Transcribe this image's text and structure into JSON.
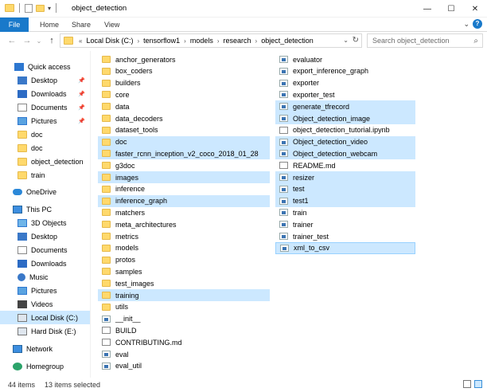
{
  "titlebar": {
    "title": "object_detection",
    "controls": {
      "minimize": "—",
      "maximize": "☐",
      "close": "✕"
    }
  },
  "ribbon": {
    "tabs": [
      "File",
      "Home",
      "Share",
      "View"
    ],
    "expand": "⌄",
    "help": "?"
  },
  "address": {
    "nav": {
      "back": "←",
      "forward": "→",
      "recent": "⌄",
      "up": "↑"
    },
    "crumbs": [
      "Local Disk (C:)",
      "tensorflow1",
      "models",
      "research",
      "object_detection"
    ],
    "search_placeholder": "Search object_detection"
  },
  "navpane": {
    "items": [
      {
        "label": "Quick access",
        "icon": "star-icon"
      },
      {
        "label": "Desktop",
        "icon": "desktop-icon",
        "pinned": true
      },
      {
        "label": "Downloads",
        "icon": "downloads-icon",
        "pinned": true
      },
      {
        "label": "Documents",
        "icon": "documents-icon",
        "pinned": true
      },
      {
        "label": "Pictures",
        "icon": "pictures-icon",
        "pinned": true
      },
      {
        "label": "doc",
        "icon": "folder-icon"
      },
      {
        "label": "doc",
        "icon": "folder-icon"
      },
      {
        "label": "object_detection",
        "icon": "folder-icon"
      },
      {
        "label": "train",
        "icon": "folder-icon"
      },
      {
        "label": "OneDrive",
        "icon": "onedrive-icon"
      },
      {
        "label": "This PC",
        "icon": "this-pc-icon"
      },
      {
        "label": "3D Objects",
        "icon": "3d-objects-icon"
      },
      {
        "label": "Desktop",
        "icon": "desktop-icon"
      },
      {
        "label": "Documents",
        "icon": "documents-icon"
      },
      {
        "label": "Downloads",
        "icon": "downloads-icon"
      },
      {
        "label": "Music",
        "icon": "music-icon"
      },
      {
        "label": "Pictures",
        "icon": "pictures-icon"
      },
      {
        "label": "Videos",
        "icon": "videos-icon"
      },
      {
        "label": "Local Disk (C:)",
        "icon": "drive-icon",
        "selected": true
      },
      {
        "label": "Hard Disk (E:)",
        "icon": "drive-icon"
      },
      {
        "label": "Network",
        "icon": "network-icon"
      },
      {
        "label": "Homegroup",
        "icon": "homegroup-icon"
      }
    ]
  },
  "files": {
    "col1": [
      {
        "name": "anchor_generators",
        "type": "folder"
      },
      {
        "name": "box_coders",
        "type": "folder"
      },
      {
        "name": "builders",
        "type": "folder"
      },
      {
        "name": "core",
        "type": "folder"
      },
      {
        "name": "data",
        "type": "folder"
      },
      {
        "name": "data_decoders",
        "type": "folder"
      },
      {
        "name": "dataset_tools",
        "type": "folder"
      },
      {
        "name": "doc",
        "type": "folder",
        "selected": true
      },
      {
        "name": "faster_rcnn_inception_v2_coco_2018_01_28",
        "type": "folder",
        "selected": true
      },
      {
        "name": "g3doc",
        "type": "folder"
      },
      {
        "name": "images",
        "type": "folder",
        "selected": true
      },
      {
        "name": "inference",
        "type": "folder"
      },
      {
        "name": "inference_graph",
        "type": "folder",
        "selected": true
      },
      {
        "name": "matchers",
        "type": "folder"
      },
      {
        "name": "meta_architectures",
        "type": "folder"
      },
      {
        "name": "metrics",
        "type": "folder"
      },
      {
        "name": "models",
        "type": "folder"
      },
      {
        "name": "protos",
        "type": "folder"
      },
      {
        "name": "samples",
        "type": "folder"
      },
      {
        "name": "test_images",
        "type": "folder"
      },
      {
        "name": "training",
        "type": "folder",
        "selected": true
      },
      {
        "name": "utils",
        "type": "folder"
      },
      {
        "name": "__init__",
        "type": "py"
      },
      {
        "name": "BUILD",
        "type": "doc"
      },
      {
        "name": "CONTRIBUTING.md",
        "type": "doc"
      },
      {
        "name": "eval",
        "type": "py"
      },
      {
        "name": "eval_util",
        "type": "py"
      }
    ],
    "col2": [
      {
        "name": "evaluator",
        "type": "py"
      },
      {
        "name": "export_inference_graph",
        "type": "py"
      },
      {
        "name": "exporter",
        "type": "py"
      },
      {
        "name": "exporter_test",
        "type": "py"
      },
      {
        "name": "generate_tfrecord",
        "type": "py",
        "selected": true
      },
      {
        "name": "Object_detection_image",
        "type": "py",
        "selected": true
      },
      {
        "name": "object_detection_tutorial.ipynb",
        "type": "doc"
      },
      {
        "name": "Object_detection_video",
        "type": "py",
        "selected": true
      },
      {
        "name": "Object_detection_webcam",
        "type": "py",
        "selected": true
      },
      {
        "name": "README.md",
        "type": "doc"
      },
      {
        "name": "resizer",
        "type": "py",
        "selected": true
      },
      {
        "name": "test",
        "type": "py",
        "selected": true
      },
      {
        "name": "test1",
        "type": "py",
        "selected": true
      },
      {
        "name": "train",
        "type": "py"
      },
      {
        "name": "trainer",
        "type": "py"
      },
      {
        "name": "trainer_test",
        "type": "py"
      },
      {
        "name": "xml_to_csv",
        "type": "py",
        "selected": true,
        "focused": true
      }
    ]
  },
  "status": {
    "count": "44 items",
    "selected": "13 items selected"
  }
}
